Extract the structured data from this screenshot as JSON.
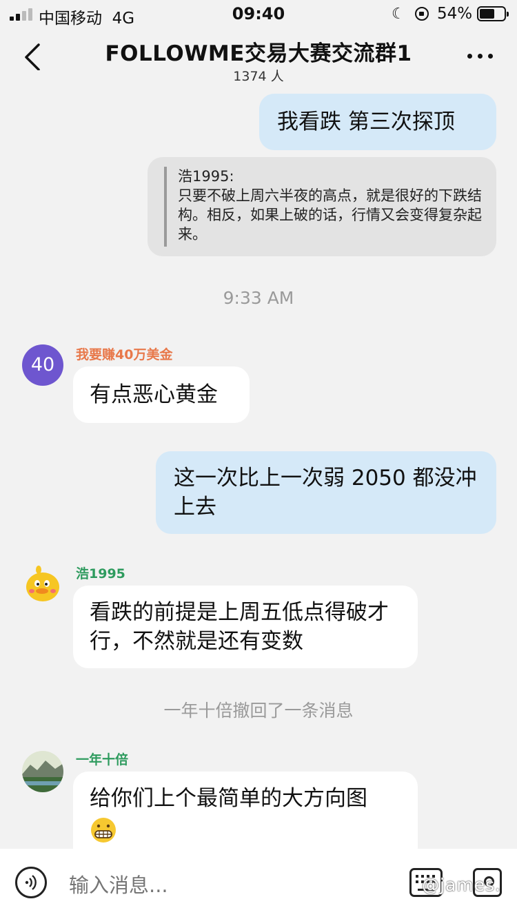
{
  "status_bar": {
    "carrier": "中国移动",
    "network": "4G",
    "time": "09:40",
    "battery_pct": "54%"
  },
  "header": {
    "title": "FOLLOWME交易大赛交流群1",
    "members": "1374 人"
  },
  "messages": {
    "m1_text": "我看跌 第三次探顶",
    "quote_author": "浩1995:",
    "quote_text": "只要不破上周六半夜的高点，就是很好的下跌结构。相反，如果上破的话，行情又会变得复杂起来。",
    "timestamp": "9:33 AM",
    "m2_avatar": "40",
    "m2_sender": "我要赚40万美金",
    "m2_sender_color": "#e8784a",
    "m2_text": "有点恶心黄金",
    "m3_text": "这一次比上一次弱 2050 都没冲上去",
    "m4_sender": "浩1995",
    "m4_sender_color": "#2e9b5e",
    "m4_text": "看跌的前提是上周五低点得破才行，不然就是还有变数",
    "recall_notice": "一年十倍撤回了一条消息",
    "m5_sender": "一年十倍",
    "m5_sender_color": "#2e9b5e",
    "m5_text": "给你们上个最简单的大方向图",
    "m5_emoji": "grimacing-emoji"
  },
  "input": {
    "placeholder": "输入消息..."
  },
  "watermark": "@james."
}
